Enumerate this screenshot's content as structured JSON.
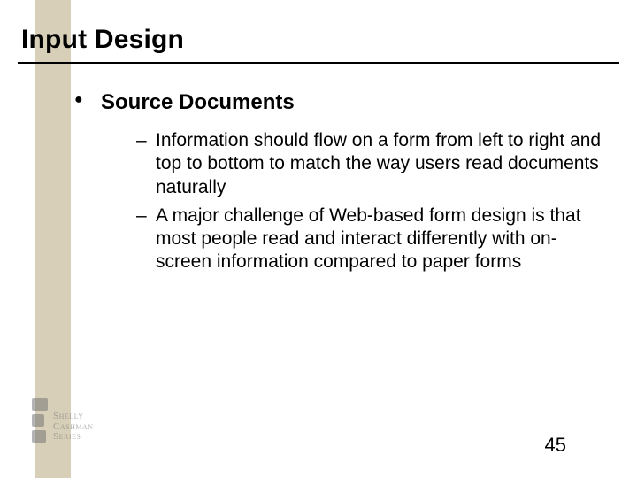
{
  "title": "Input Design",
  "bullets": [
    {
      "label": "Source Documents"
    }
  ],
  "sub_bullets": [
    "Information should flow on a form from left to right and top to bottom to match the way users read documents naturally",
    "A major challenge of Web-based form design is that most people read and interact differently with on-screen information compared to paper forms"
  ],
  "page_number": "45",
  "logo": {
    "line1": "Shelly",
    "line2": "Cashman",
    "line3": "Series"
  }
}
